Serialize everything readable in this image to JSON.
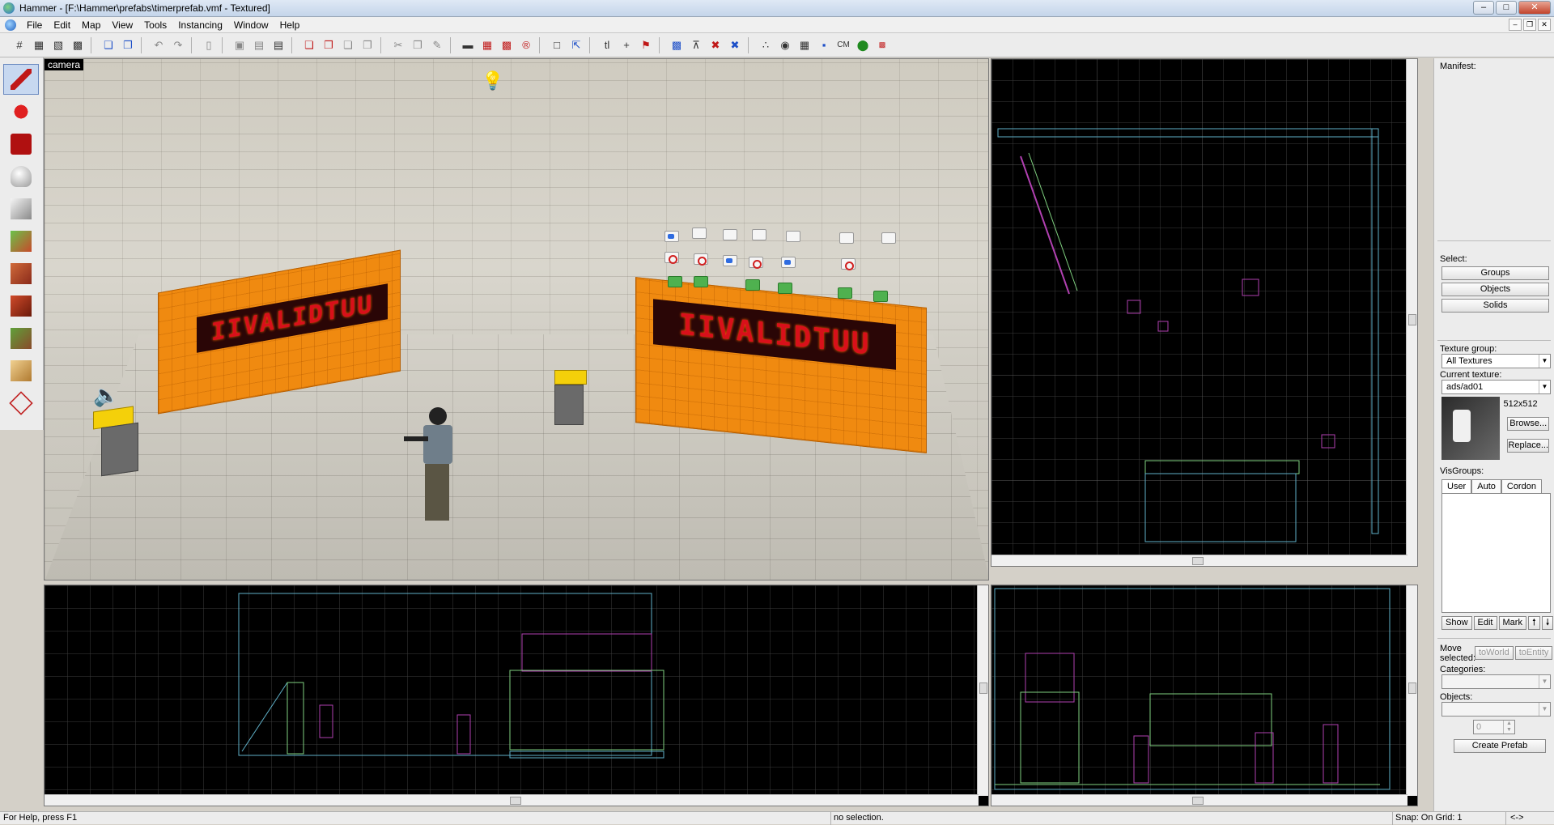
{
  "window": {
    "title": "Hammer - [F:\\Hammer\\prefabs\\timerprefab.vmf - Textured]"
  },
  "menu": [
    "File",
    "Edit",
    "Map",
    "View",
    "Tools",
    "Instancing",
    "Window",
    "Help"
  ],
  "toolbar": {
    "cm_label": "CM"
  },
  "camera": {
    "label": "camera",
    "sign_text": "IIVALIDTUU"
  },
  "right_panel": {
    "manifest_label": "Manifest:",
    "select_label": "Select:",
    "groups_btn": "Groups",
    "objects_btn": "Objects",
    "solids_btn": "Solids",
    "texture_group_label": "Texture group:",
    "texture_group_value": "All Textures",
    "current_texture_label": "Current texture:",
    "current_texture_value": "ads/ad01",
    "texture_size": "512x512",
    "browse_btn": "Browse...",
    "replace_btn": "Replace...",
    "visgroups_label": "VisGroups:",
    "tabs": [
      "User",
      "Auto",
      "Cordon"
    ],
    "show_btn": "Show",
    "edit_btn": "Edit",
    "mark_btn": "Mark",
    "move_selected_label": "Move selected:",
    "to_world_btn": "toWorld",
    "to_entity_btn": "toEntity",
    "categories_label": "Categories:",
    "objects_label": "Objects:",
    "count_value": "0",
    "create_prefab_btn": "Create Prefab"
  },
  "status": {
    "help": "For Help, press F1",
    "selection": "no selection.",
    "snap": "Snap: On Grid: 1",
    "arrows": "<->"
  },
  "colors": {
    "accent_orange": "#f08a10",
    "grid_line": "#4a4a4a",
    "brush_green": "#7fd07f",
    "brush_magenta": "#b040b0",
    "brush_cyan": "#5fb0c8"
  }
}
